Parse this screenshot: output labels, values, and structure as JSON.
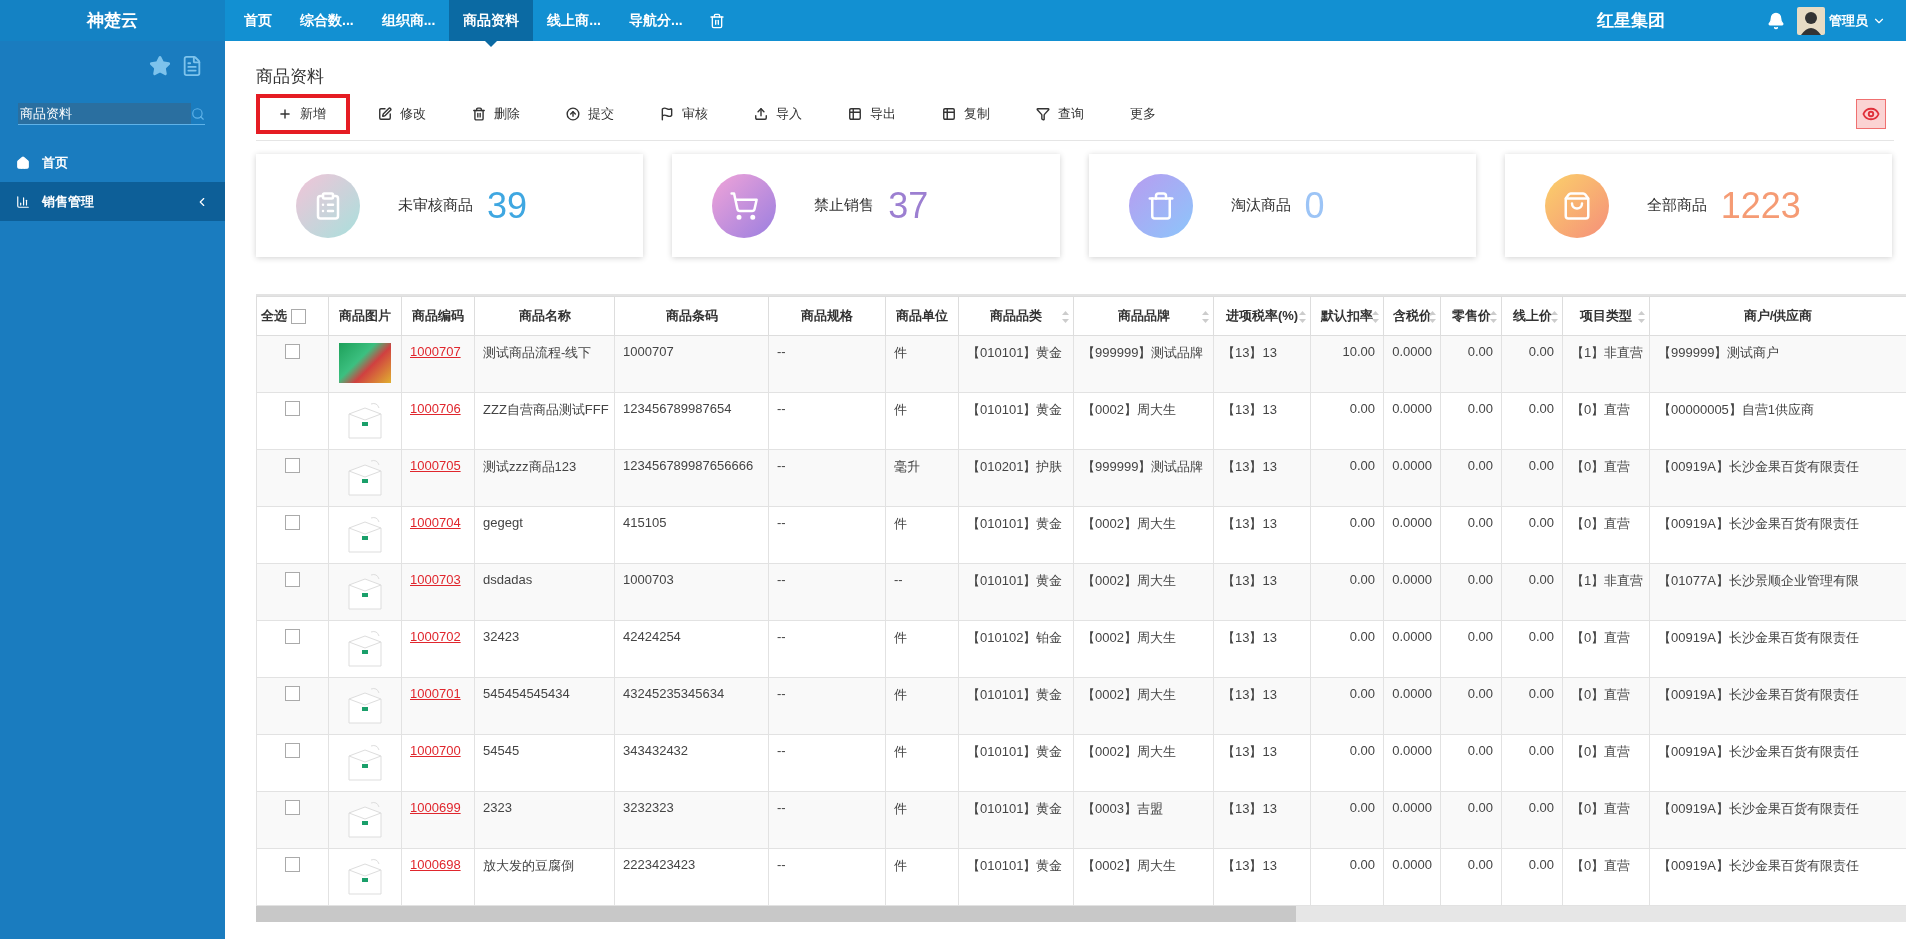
{
  "brand": "神楚云",
  "nav": [
    {
      "label": "首页",
      "selected": false
    },
    {
      "label": "综合数...",
      "selected": false
    },
    {
      "label": "组织商...",
      "selected": false
    },
    {
      "label": "商品资料",
      "selected": true
    },
    {
      "label": "线上商...",
      "selected": false
    },
    {
      "label": "导航分...",
      "selected": false
    }
  ],
  "company": "红星集团",
  "user": "管理员",
  "sidebar": {
    "search": {
      "value": "商品资料"
    },
    "items": [
      {
        "label": "首页",
        "selected": false
      },
      {
        "label": "销售管理",
        "selected": true
      }
    ]
  },
  "page_title": "商品资料",
  "toolbar": [
    {
      "label": "新增",
      "highlighted": true
    },
    {
      "label": "修改",
      "highlighted": false
    },
    {
      "label": "删除",
      "highlighted": false
    },
    {
      "label": "提交",
      "highlighted": false
    },
    {
      "label": "审核",
      "highlighted": false
    },
    {
      "label": "导入",
      "highlighted": false
    },
    {
      "label": "导出",
      "highlighted": false
    },
    {
      "label": "复制",
      "highlighted": false
    },
    {
      "label": "查询",
      "highlighted": false
    },
    {
      "label": "更多",
      "highlighted": false
    }
  ],
  "cards": [
    {
      "label": "未审核商品",
      "value": "39",
      "color": "#3fa7e1"
    },
    {
      "label": "禁止销售",
      "value": "37",
      "color": "#9c7fd1"
    },
    {
      "label": "淘汰商品",
      "value": "0",
      "color": "#9cc4f6"
    },
    {
      "label": "全部商品",
      "value": "1223",
      "color": "#f59b74"
    }
  ],
  "table": {
    "select_all": {
      "label": "全选",
      "checked": false
    },
    "image_column": {
      "label": "商品图片"
    },
    "columns": [
      {
        "label": "商品编码",
        "sortable": false
      },
      {
        "label": "商品名称",
        "sortable": false
      },
      {
        "label": "商品条码",
        "sortable": false
      },
      {
        "label": "商品规格",
        "sortable": false
      },
      {
        "label": "商品单位",
        "sortable": false
      },
      {
        "label": "商品品类",
        "sortable": true
      },
      {
        "label": "商品品牌",
        "sortable": true
      },
      {
        "label": "进项税率(%)",
        "sortable": true
      },
      {
        "label": "默认扣率",
        "sortable": true
      },
      {
        "label": "含税价",
        "sortable": true
      },
      {
        "label": "零售价",
        "sortable": true
      },
      {
        "label": "线上价",
        "sortable": true
      },
      {
        "label": "项目类型",
        "sortable": true
      },
      {
        "label": "商户/供应商",
        "sortable": false
      }
    ],
    "rows": [
      {
        "checked": false,
        "kind": "photo",
        "cells": [
          "1000707",
          "测试商品流程-线下",
          "1000707",
          "--",
          "件",
          "【010101】黄金",
          "【999999】测试品牌",
          "【13】13",
          "10.00",
          "0.0000",
          "0.00",
          "0.00",
          "【1】非直营",
          "【999999】测试商户"
        ]
      },
      {
        "checked": false,
        "kind": "placeholder",
        "cells": [
          "1000706",
          "ZZZ自营商品测试FFF",
          "123456789987654",
          "--",
          "件",
          "【010101】黄金",
          "【0002】周大生",
          "【13】13",
          "0.00",
          "0.0000",
          "0.00",
          "0.00",
          "【0】直营",
          "【00000005】自营1供应商"
        ]
      },
      {
        "checked": false,
        "kind": "placeholder",
        "cells": [
          "1000705",
          "测试zzz商品123",
          "123456789987656666",
          "--",
          "毫升",
          "【010201】护肤",
          "【999999】测试品牌",
          "【13】13",
          "0.00",
          "0.0000",
          "0.00",
          "0.00",
          "【0】直营",
          "【00919A】长沙金果百货有限责任"
        ]
      },
      {
        "checked": false,
        "kind": "placeholder",
        "cells": [
          "1000704",
          "gegegt",
          "415105",
          "--",
          "件",
          "【010101】黄金",
          "【0002】周大生",
          "【13】13",
          "0.00",
          "0.0000",
          "0.00",
          "0.00",
          "【0】直营",
          "【00919A】长沙金果百货有限责任"
        ]
      },
      {
        "checked": false,
        "kind": "placeholder",
        "cells": [
          "1000703",
          "dsdadas",
          "1000703",
          "--",
          "--",
          "【010101】黄金",
          "【0002】周大生",
          "【13】13",
          "0.00",
          "0.0000",
          "0.00",
          "0.00",
          "【1】非直营",
          "【01077A】长沙景顺企业管理有限"
        ]
      },
      {
        "checked": false,
        "kind": "placeholder",
        "cells": [
          "1000702",
          "32423",
          "42424254",
          "--",
          "件",
          "【010102】铂金",
          "【0002】周大生",
          "【13】13",
          "0.00",
          "0.0000",
          "0.00",
          "0.00",
          "【0】直营",
          "【00919A】长沙金果百货有限责任"
        ]
      },
      {
        "checked": false,
        "kind": "placeholder",
        "cells": [
          "1000701",
          "545454545434",
          "43245235345634",
          "--",
          "件",
          "【010101】黄金",
          "【0002】周大生",
          "【13】13",
          "0.00",
          "0.0000",
          "0.00",
          "0.00",
          "【0】直营",
          "【00919A】长沙金果百货有限责任"
        ]
      },
      {
        "checked": false,
        "kind": "placeholder",
        "cells": [
          "1000700",
          "54545",
          "343432432",
          "--",
          "件",
          "【010101】黄金",
          "【0002】周大生",
          "【13】13",
          "0.00",
          "0.0000",
          "0.00",
          "0.00",
          "【0】直营",
          "【00919A】长沙金果百货有限责任"
        ]
      },
      {
        "checked": false,
        "kind": "placeholder",
        "cells": [
          "1000699",
          "2323",
          "3232323",
          "--",
          "件",
          "【010101】黄金",
          "【0003】吉盟",
          "【13】13",
          "0.00",
          "0.0000",
          "0.00",
          "0.00",
          "【0】直营",
          "【00919A】长沙金果百货有限责任"
        ]
      },
      {
        "checked": false,
        "kind": "placeholder",
        "cells": [
          "1000698",
          "放大发的豆腐倒",
          "2223423423",
          "--",
          "件",
          "【010101】黄金",
          "【0002】周大生",
          "【13】13",
          "0.00",
          "0.0000",
          "0.00",
          "0.00",
          "【0】直营",
          "【00919A】长沙金果百货有限责任"
        ]
      }
    ]
  }
}
